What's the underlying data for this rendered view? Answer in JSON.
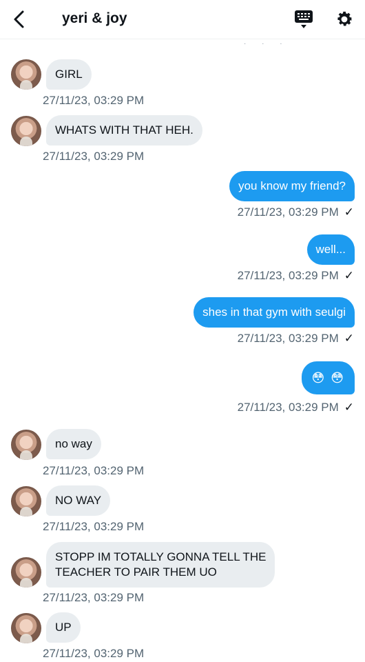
{
  "header": {
    "title": "yeri & joy",
    "back_icon": "chevron-left-icon",
    "keyboard_icon": "keyboard-icon",
    "settings_icon": "gear-icon",
    "overflow_dots": "· · ·"
  },
  "colors": {
    "outgoing_bubble": "#1d9bf0",
    "incoming_bubble": "#e9edf0",
    "timestamp": "#536471"
  },
  "messages": [
    {
      "dir": "in",
      "text": "GIRL",
      "time": "27/11/23, 03:29 PM"
    },
    {
      "dir": "in",
      "text": "WHATS WITH THAT HEH.",
      "time": "27/11/23, 03:29 PM"
    },
    {
      "dir": "out",
      "text": "you know my friend?",
      "time": "27/11/23, 03:29 PM",
      "check": "✓"
    },
    {
      "dir": "out",
      "text": "well...",
      "time": "27/11/23, 03:29 PM",
      "check": "✓"
    },
    {
      "dir": "out",
      "text": "shes in that gym with seulgi",
      "time": "27/11/23, 03:29 PM",
      "check": "✓"
    },
    {
      "dir": "out",
      "text": "😳 😳",
      "time": "27/11/23, 03:29 PM",
      "check": "✓"
    },
    {
      "dir": "in",
      "text": "no way",
      "time": "27/11/23, 03:29 PM"
    },
    {
      "dir": "in",
      "text": "NO WAY",
      "time": "27/11/23, 03:29 PM"
    },
    {
      "dir": "in",
      "text": "STOPP IM TOTALLY GONNA TELL THE\nTEACHER TO PAIR THEM UO",
      "time": "27/11/23, 03:29 PM"
    },
    {
      "dir": "in",
      "text": "UP",
      "time": "27/11/23, 03:29 PM"
    }
  ]
}
